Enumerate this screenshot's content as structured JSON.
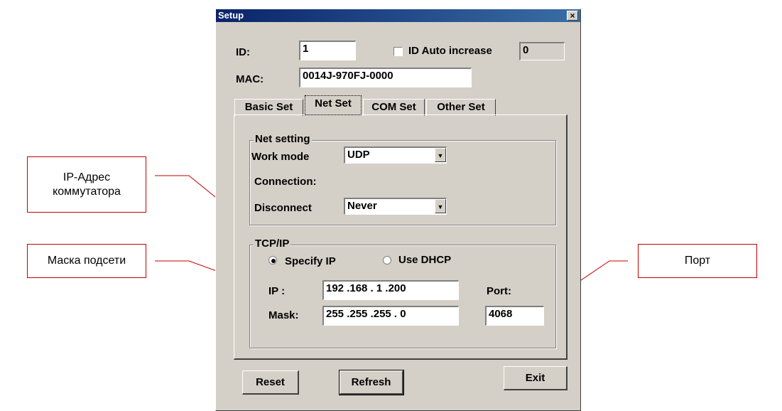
{
  "window": {
    "title": "Setup",
    "close_glyph": "×",
    "close_icon": "close-icon"
  },
  "id": {
    "label": "ID:",
    "value": "1"
  },
  "id_auto": {
    "label": "ID Auto increase",
    "checked": false,
    "value": "0"
  },
  "mac": {
    "label": "MAC:",
    "value": "0014J-970FJ-0000"
  },
  "tabs": [
    {
      "label": "Basic Set",
      "active": false
    },
    {
      "label": "Net Set",
      "active": true
    },
    {
      "label": "COM Set",
      "active": false
    },
    {
      "label": "Other Set",
      "active": false
    }
  ],
  "net_setting": {
    "title": "Net setting",
    "work_mode_label": "Work mode",
    "work_mode_value": "UDP",
    "connection_label": "Connection:",
    "disconnect_label": "Disconnect",
    "disconnect_value": "Never"
  },
  "tcpip": {
    "title": "TCP/IP",
    "specify_ip_label": "Specify IP",
    "specify_ip_selected": true,
    "use_dhcp_label": "Use DHCP",
    "use_dhcp_selected": false,
    "ip_label": "IP :",
    "ip_value": "192 .168 .  1  .200",
    "mask_label": "Mask:",
    "mask_value": "255 .255 .255 .  0",
    "port_label": "Port:",
    "port_value": "4068"
  },
  "buttons": {
    "reset": "Reset",
    "refresh": "Refresh",
    "exit": "Exit"
  },
  "annotations": {
    "ip_address": "IP-Адрес коммутатора",
    "mask": "Маска подсети",
    "port": "Порт",
    "line_color": "#c00000"
  },
  "colors": {
    "dialog_bg": "#d4d0c8",
    "title_bg": "#0a246a"
  }
}
